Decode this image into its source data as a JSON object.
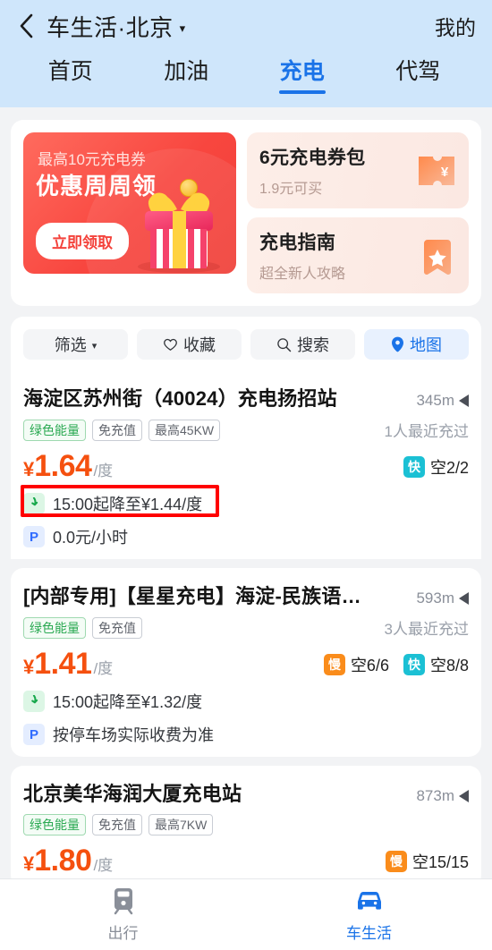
{
  "header": {
    "back_icon": "chevron-left-icon",
    "title": "车生活·北京",
    "caret": "▾",
    "mine_label": "我的",
    "tabs": [
      {
        "label": "首页",
        "active": false
      },
      {
        "label": "加油",
        "active": false
      },
      {
        "label": "充电",
        "active": true
      },
      {
        "label": "代驾",
        "active": false
      }
    ],
    "background_color": "#cfe6fb",
    "accent_color": "#1a73e8"
  },
  "promo": {
    "banner": {
      "subtitle": "最高10元充电券",
      "title": "优惠周周领",
      "button_label": "立即领取",
      "background_color": "#f8463f",
      "icon": "gift-box-icon"
    },
    "cards": [
      {
        "title": "6元充电券包",
        "subtitle": "1.9元可买",
        "icon": "coupon-ticket-icon"
      },
      {
        "title": "充电指南",
        "subtitle": "超全新人攻略",
        "icon": "bookmark-star-icon"
      }
    ]
  },
  "toolbar": {
    "chips": [
      {
        "label": "筛选",
        "icon": "chevron-down-icon",
        "active": false
      },
      {
        "label": "收藏",
        "icon": "heart-icon",
        "active": false
      },
      {
        "label": "搜索",
        "icon": "search-icon",
        "active": false
      },
      {
        "label": "地图",
        "icon": "location-pin-icon",
        "active": true
      }
    ]
  },
  "stations": [
    {
      "name": "海淀区苏州街（40024）充电扬招站",
      "distance": "345m",
      "tags": [
        "绿色能量",
        "免充值",
        "最高45KW"
      ],
      "users": "1人最近充过",
      "price_currency": "¥",
      "price": "1.64",
      "price_unit": "/度",
      "availability": [
        {
          "type": "快",
          "text": "空2/2",
          "color": "#1bc0d4"
        }
      ],
      "info": [
        {
          "icon": "price-drop-icon",
          "text": "15:00起降至¥1.44/度",
          "highlighted": true
        },
        {
          "icon": "parking-icon",
          "text": "0.0元/小时",
          "highlighted": false
        }
      ]
    },
    {
      "name": "[内部专用]【星星充电】海淀-民族语…",
      "distance": "593m",
      "tags": [
        "绿色能量",
        "免充值"
      ],
      "users": "3人最近充过",
      "price_currency": "¥",
      "price": "1.41",
      "price_unit": "/度",
      "availability": [
        {
          "type": "慢",
          "text": "空6/6",
          "color": "#fa8c1b"
        },
        {
          "type": "快",
          "text": "空8/8",
          "color": "#1bc0d4"
        }
      ],
      "info": [
        {
          "icon": "price-drop-icon",
          "text": "15:00起降至¥1.32/度",
          "highlighted": false
        },
        {
          "icon": "parking-icon",
          "text": "按停车场实际收费为准",
          "highlighted": false
        }
      ]
    },
    {
      "name": "北京美华海润大厦充电站",
      "distance": "873m",
      "tags": [
        "绿色能量",
        "免充值",
        "最高7KW"
      ],
      "users": "",
      "price_currency": "¥",
      "price": "1.80",
      "price_unit": "/度",
      "availability": [
        {
          "type": "慢",
          "text": "空15/15",
          "color": "#fa8c1b"
        }
      ],
      "info": []
    }
  ],
  "tabbar": {
    "items": [
      {
        "label": "出行",
        "icon": "train-icon",
        "active": false
      },
      {
        "label": "车生活",
        "icon": "car-icon",
        "active": true
      }
    ]
  }
}
